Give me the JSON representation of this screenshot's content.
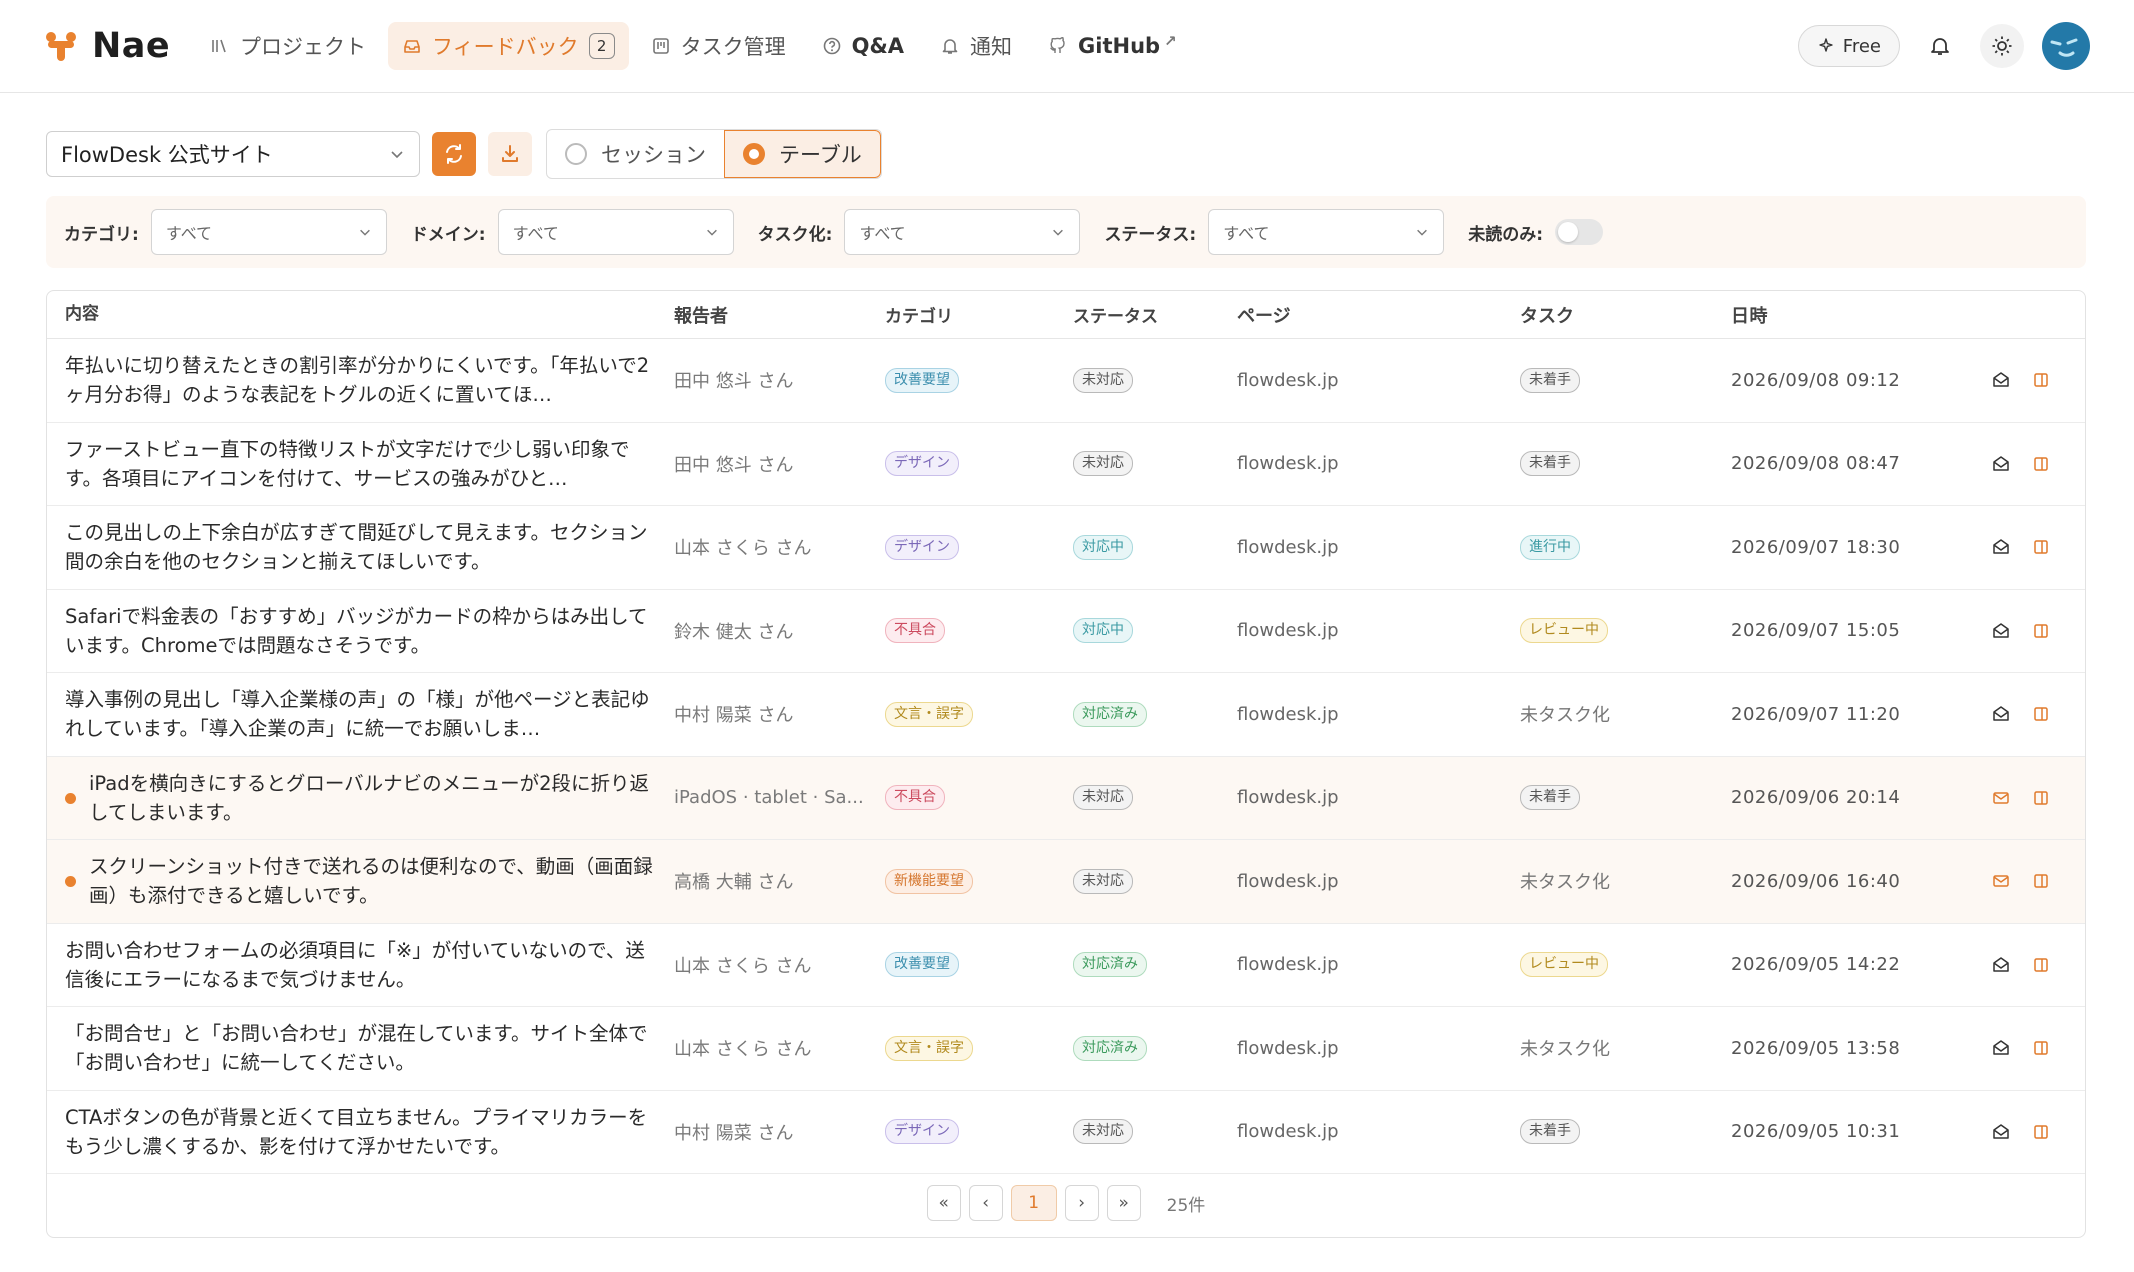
{
  "app": {
    "name": "Nae"
  },
  "nav": [
    {
      "label": "プロジェクト",
      "icon": "library-icon"
    },
    {
      "label": "フィードバック",
      "icon": "inbox-icon",
      "badge": "2",
      "active": true
    },
    {
      "label": "タスク管理",
      "icon": "kanban-icon"
    },
    {
      "label": "Q&A",
      "icon": "question-icon"
    },
    {
      "label": "通知",
      "icon": "bell-icon"
    },
    {
      "label": "GitHub",
      "icon": "github-icon",
      "external": "↗"
    }
  ],
  "header_right": {
    "plan_label": "Free"
  },
  "toolbar": {
    "project": "FlowDesk 公式サイト",
    "view_session": "セッション",
    "view_table": "テーブル"
  },
  "filters": {
    "category": {
      "label": "カテゴリ:",
      "value": "すべて"
    },
    "domain": {
      "label": "ドメイン:",
      "value": "すべて"
    },
    "tasked": {
      "label": "タスク化:",
      "value": "すべて"
    },
    "status": {
      "label": "ステータス:",
      "value": "すべて"
    },
    "unread_only": {
      "label": "未読のみ:"
    }
  },
  "table": {
    "headers": {
      "content": "内容",
      "reporter": "報告者",
      "category": "カテゴリ",
      "status": "ステータス",
      "page": "ページ",
      "task": "タスク",
      "date": "日時"
    },
    "rows": [
      {
        "content": "年払いに切り替えたときの割引率が分かりにくいです。「年払いで2ヶ月分お得」のような表記をトグルの近くに置いてほ…",
        "reporter": "田中 悠斗 さん",
        "category": "改善要望",
        "cat_class": "b-kaizen",
        "status": "未対応",
        "st_class": "b-gray",
        "page": "flowdesk.jp",
        "task": "未着手",
        "task_class": "b-gray",
        "date": "2026/09/08 09:12",
        "unread": false
      },
      {
        "content": "ファーストビュー直下の特徴リストが文字だけで少し弱い印象です。各項目にアイコンを付けて、サービスの強みがひと…",
        "reporter": "田中 悠斗 さん",
        "category": "デザイン",
        "cat_class": "b-design",
        "status": "未対応",
        "st_class": "b-gray",
        "page": "flowdesk.jp",
        "task": "未着手",
        "task_class": "b-gray",
        "date": "2026/09/08 08:47",
        "unread": false
      },
      {
        "content": "この見出しの上下余白が広すぎて間延びして見えます。セクション間の余白を他のセクションと揃えてほしいです。",
        "reporter": "山本 さくら さん",
        "category": "デザイン",
        "cat_class": "b-design",
        "status": "対応中",
        "st_class": "b-teal",
        "page": "flowdesk.jp",
        "task": "進行中",
        "task_class": "b-teal",
        "date": "2026/09/07 18:30",
        "unread": false
      },
      {
        "content": "Safariで料金表の「おすすめ」バッジがカードの枠からはみ出しています。Chromeでは問題なさそうです。",
        "reporter": "鈴木 健太 さん",
        "category": "不具合",
        "cat_class": "b-bug",
        "status": "対応中",
        "st_class": "b-teal",
        "page": "flowdesk.jp",
        "task": "レビュー中",
        "task_class": "b-yellow",
        "date": "2026/09/07 15:05",
        "unread": false
      },
      {
        "content": "導入事例の見出し「導入企業様の声」の「様」が他ページと表記ゆれしています。「導入企業の声」に統一でお願いしま…",
        "reporter": "中村 陽菜 さん",
        "category": "文言・誤字",
        "cat_class": "b-text",
        "status": "対応済み",
        "st_class": "b-green",
        "page": "flowdesk.jp",
        "task": "未タスク化",
        "task_class": "",
        "date": "2026/09/07 11:20",
        "unread": false
      },
      {
        "content": "iPadを横向きにするとグローバルナビのメニューが2段に折り返してしまいます。",
        "reporter": "iPadOS · tablet · Sa...",
        "category": "不具合",
        "cat_class": "b-bug",
        "status": "未対応",
        "st_class": "b-gray",
        "page": "flowdesk.jp",
        "task": "未着手",
        "task_class": "b-gray",
        "date": "2026/09/06 20:14",
        "unread": true
      },
      {
        "content": "スクリーンショット付きで送れるのは便利なので、動画（画面録画）も添付できると嬉しいです。",
        "reporter": "高橋 大輔 さん",
        "category": "新機能要望",
        "cat_class": "b-new",
        "status": "未対応",
        "st_class": "b-gray",
        "page": "flowdesk.jp",
        "task": "未タスク化",
        "task_class": "",
        "date": "2026/09/06 16:40",
        "unread": true
      },
      {
        "content": "お問い合わせフォームの必須項目に「※」が付いていないので、送信後にエラーになるまで気づけません。",
        "reporter": "山本 さくら さん",
        "category": "改善要望",
        "cat_class": "b-kaizen",
        "status": "対応済み",
        "st_class": "b-green",
        "page": "flowdesk.jp",
        "task": "レビュー中",
        "task_class": "b-yellow",
        "date": "2026/09/05 14:22",
        "unread": false
      },
      {
        "content": "「お問合せ」と「お問い合わせ」が混在しています。サイト全体で「お問い合わせ」に統一してください。",
        "reporter": "山本 さくら さん",
        "category": "文言・誤字",
        "cat_class": "b-text",
        "status": "対応済み",
        "st_class": "b-green",
        "page": "flowdesk.jp",
        "task": "未タスク化",
        "task_class": "",
        "date": "2026/09/05 13:58",
        "unread": false
      },
      {
        "content": "CTAボタンの色が背景と近くて目立ちません。プライマリカラーをもう少し濃くするか、影を付けて浮かせたいです。",
        "reporter": "中村 陽菜 さん",
        "category": "デザイン",
        "cat_class": "b-design",
        "status": "未対応",
        "st_class": "b-gray",
        "page": "flowdesk.jp",
        "task": "未着手",
        "task_class": "b-gray",
        "date": "2026/09/05 10:31",
        "unread": false
      }
    ]
  },
  "pagination": {
    "first": "«",
    "prev": "‹",
    "current": "1",
    "next": "›",
    "last": "»",
    "total": "25件"
  },
  "colors": {
    "accent": "#e9822f",
    "accent_soft": "#fbeee4",
    "avatar": "#2379a8"
  }
}
